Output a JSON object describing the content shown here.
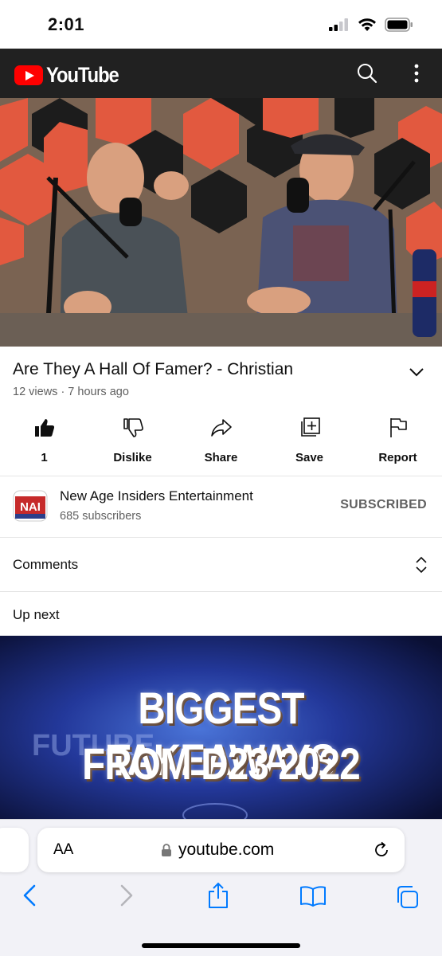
{
  "status": {
    "time": "2:01"
  },
  "header": {
    "brand": "YouTube",
    "icons": [
      "search-icon",
      "more-vert-icon"
    ]
  },
  "video": {
    "title": "Are They A Hall Of Famer? - Christian",
    "meta": "12 views · 7 hours ago"
  },
  "actions": [
    {
      "label": "1",
      "icon": "thumbs-up-filled-icon"
    },
    {
      "label": "Dislike",
      "icon": "thumbs-down-icon"
    },
    {
      "label": "Share",
      "icon": "share-arrow-icon"
    },
    {
      "label": "Save",
      "icon": "add-to-playlist-icon"
    },
    {
      "label": "Report",
      "icon": "flag-icon"
    }
  ],
  "channel": {
    "avatar_text": "NAI",
    "name": "New Age Insiders Entertainment",
    "subscribers": "685 subscribers",
    "subscribe_state": "SUBSCRIBED"
  },
  "comments": {
    "label": "Comments"
  },
  "upnext": {
    "label": "Up next",
    "thumbnail_line1": "BIGGEST TAKEAWAYS",
    "thumbnail_line2": "FROM D23 2022",
    "thumbnail_bg_text": "FUTURE"
  },
  "safari": {
    "text_size_label": "AA",
    "url": "youtube.com"
  },
  "colors": {
    "youtube_red": "#ff0000",
    "header_bg": "#212121",
    "ios_blue": "#007aff"
  }
}
